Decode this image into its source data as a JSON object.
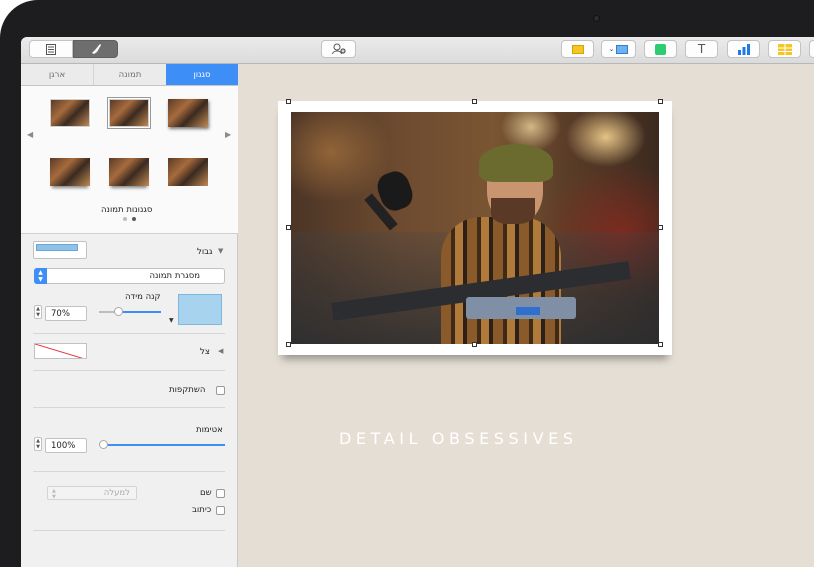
{
  "sidebar": {
    "tabs": [
      {
        "label": "ארגן",
        "active": false
      },
      {
        "label": "תמונה",
        "active": false
      },
      {
        "label": "סגנון",
        "active": true
      }
    ],
    "styles_label": "סגנונות תמונה",
    "border": {
      "label": "גבול",
      "type_value": "מסגרת תמונה",
      "size_label": "קנה מידה",
      "scale_value": "70%",
      "scale_fraction": 0.7
    },
    "shadow_label": "צל",
    "reflection_label": "השתקפות",
    "opacity": {
      "label": "אטימות",
      "value": "100%",
      "fraction": 1.0
    },
    "caption": {
      "title_label": "שם",
      "caption_label": "כיתוב",
      "position_placeholder": "למעלה"
    }
  },
  "canvas": {
    "headline": "DETAIL OBSESSIVES"
  },
  "colors": {
    "accent": "#3d8ef6",
    "canvas_bg": "#e4ded5",
    "comment_yellow": "#f3c623",
    "shape_green": "#2ecc71",
    "chart_blue": "#1e7be6"
  },
  "icons": {
    "view": "view-menu-icon",
    "format": "paintbrush-icon",
    "collaborate": "add-person-icon",
    "comment": "comment-icon",
    "media": "media-icon",
    "shape": "shape-icon",
    "text": "text-icon",
    "chart": "chart-icon",
    "table": "table-icon"
  }
}
